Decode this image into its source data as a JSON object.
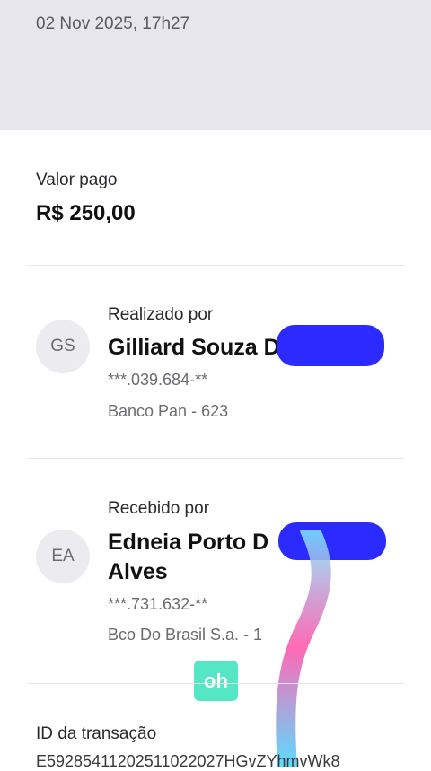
{
  "header": {
    "date": "02 Nov 2025, 17h27"
  },
  "payment": {
    "label": "Valor pago",
    "amount": "R$ 250,00"
  },
  "payer": {
    "label": "Realizado por",
    "initials": "GS",
    "name": "Gilliard Souza D",
    "document": "***.039.684-**",
    "bank": "Banco Pan - 623"
  },
  "receiver": {
    "label": "Recebido por",
    "initials": "EA",
    "name_line1": "Edneia Porto D",
    "name_line2": "Alves",
    "document": "***.731.632-**",
    "bank": "Bco Do Brasil S.a. - 1"
  },
  "sticker": {
    "text": "oh"
  },
  "transaction": {
    "label": "ID da transação",
    "id": "E592854112025110220​27HGvZYhmvWk8"
  },
  "colors": {
    "header_bg": "#e7e6ee",
    "redaction": "#2b2bff",
    "sticker": "#55e6c6"
  }
}
